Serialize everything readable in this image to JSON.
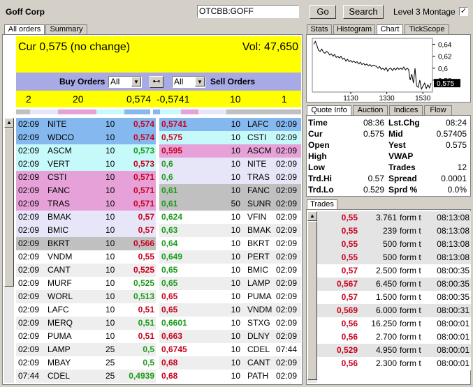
{
  "header": {
    "company": "Goff Corp",
    "symbol_value": "OTCBB:GOFF",
    "go_label": "Go",
    "search_label": "Search",
    "montage_label": "Level 3 Montage",
    "montage_checked": "✓"
  },
  "left_tabs": [
    "All orders",
    "Summary"
  ],
  "summary": {
    "cur": "Cur 0,575 (no change)",
    "vol": "Vol: 47,650"
  },
  "buy_orders_label": "Buy Orders",
  "sell_orders_label": "Sell Orders",
  "buy_filter": "All",
  "sell_filter": "All",
  "link_icon": "⊷",
  "totals": {
    "buy_count": "2",
    "buy_size": "20",
    "buy_price": "0,574",
    "sell_price": "-0,5741",
    "sell_size": "10",
    "sell_count": "1"
  },
  "bid_rows": [
    {
      "time": "02:09",
      "mm": "NITE",
      "size": "10",
      "price": "0,574",
      "c": "red",
      "bg": "#84b8ee"
    },
    {
      "time": "02:09",
      "mm": "WDCO",
      "size": "10",
      "price": "0,574",
      "c": "red",
      "bg": "#84b8ee"
    },
    {
      "time": "02:09",
      "mm": "ASCM",
      "size": "10",
      "price": "0,573",
      "c": "grn",
      "bg": "#c6fafa"
    },
    {
      "time": "02:09",
      "mm": "VERT",
      "size": "10",
      "price": "0,573",
      "c": "red",
      "bg": "#c6fafa"
    },
    {
      "time": "02:09",
      "mm": "CSTI",
      "size": "10",
      "price": "0,571",
      "c": "red",
      "bg": "#e6a2d8"
    },
    {
      "time": "02:09",
      "mm": "FANC",
      "size": "10",
      "price": "0,571",
      "c": "red",
      "bg": "#e6a2d8"
    },
    {
      "time": "02:09",
      "mm": "TRAS",
      "size": "10",
      "price": "0,571",
      "c": "red",
      "bg": "#e6a2d8"
    },
    {
      "time": "02:09",
      "mm": "BMAK",
      "size": "10",
      "price": "0,57",
      "c": "red",
      "bg": "#e6e6f8"
    },
    {
      "time": "02:09",
      "mm": "BMIC",
      "size": "10",
      "price": "0,57",
      "c": "red",
      "bg": "#e6e6f8"
    },
    {
      "time": "02:09",
      "mm": "BKRT",
      "size": "10",
      "price": "0,566",
      "c": "red",
      "bg": "#c0c0c0"
    },
    {
      "time": "02:09",
      "mm": "VNDM",
      "size": "10",
      "price": "0,55",
      "c": "red",
      "bg": "#ffffff"
    },
    {
      "time": "02:09",
      "mm": "CANT",
      "size": "10",
      "price": "0,525",
      "c": "red",
      "bg": "#eeeeee"
    },
    {
      "time": "02:09",
      "mm": "MURF",
      "size": "10",
      "price": "0,525",
      "c": "grn",
      "bg": "#ffffff"
    },
    {
      "time": "02:09",
      "mm": "WORL",
      "size": "10",
      "price": "0,513",
      "c": "grn",
      "bg": "#eeeeee"
    },
    {
      "time": "02:09",
      "mm": "LAFC",
      "size": "10",
      "price": "0,51",
      "c": "red",
      "bg": "#ffffff"
    },
    {
      "time": "02:09",
      "mm": "MERQ",
      "size": "10",
      "price": "0,51",
      "c": "grn",
      "bg": "#eeeeee"
    },
    {
      "time": "02:09",
      "mm": "PUMA",
      "size": "10",
      "price": "0,51",
      "c": "red",
      "bg": "#ffffff"
    },
    {
      "time": "02:09",
      "mm": "LAMP",
      "size": "25",
      "price": "0,5",
      "c": "grn",
      "bg": "#eeeeee"
    },
    {
      "time": "02:09",
      "mm": "MBAY",
      "size": "25",
      "price": "0,5",
      "c": "grn",
      "bg": "#ffffff"
    },
    {
      "time": "07:44",
      "mm": "CDEL",
      "size": "25",
      "price": "0,4939",
      "c": "grn",
      "bg": "#eeeeee"
    }
  ],
  "ask_rows": [
    {
      "price": "0,5741",
      "c": "red",
      "size": "10",
      "mm": "LAFC",
      "time": "02:09",
      "bg": "#84b8ee"
    },
    {
      "price": "0,575",
      "c": "red",
      "size": "10",
      "mm": "CSTI",
      "time": "02:09",
      "bg": "#c6fafa"
    },
    {
      "price": "0,595",
      "c": "red",
      "size": "10",
      "mm": "ASCM",
      "time": "02:09",
      "bg": "#e6a2d8"
    },
    {
      "price": "0,6",
      "c": "grn",
      "size": "10",
      "mm": "NITE",
      "time": "02:09",
      "bg": "#e6e6f8"
    },
    {
      "price": "0,6",
      "c": "grn",
      "size": "10",
      "mm": "TRAS",
      "time": "02:09",
      "bg": "#e6e6f8"
    },
    {
      "price": "0,61",
      "c": "grn",
      "size": "10",
      "mm": "FANC",
      "time": "02:09",
      "bg": "#c0c0c0"
    },
    {
      "price": "0,61",
      "c": "grn",
      "size": "50",
      "mm": "SUNR",
      "time": "02:09",
      "bg": "#c0c0c0"
    },
    {
      "price": "0,624",
      "c": "grn",
      "size": "10",
      "mm": "VFIN",
      "time": "02:09",
      "bg": "#ffffff"
    },
    {
      "price": "0,63",
      "c": "grn",
      "size": "10",
      "mm": "BMAK",
      "time": "02:09",
      "bg": "#eeeeee"
    },
    {
      "price": "0,64",
      "c": "grn",
      "size": "10",
      "mm": "BKRT",
      "time": "02:09",
      "bg": "#ffffff"
    },
    {
      "price": "0,649",
      "c": "grn",
      "size": "10",
      "mm": "PERT",
      "time": "02:09",
      "bg": "#eeeeee"
    },
    {
      "price": "0,65",
      "c": "grn",
      "size": "10",
      "mm": "BMIC",
      "time": "02:09",
      "bg": "#ffffff"
    },
    {
      "price": "0,65",
      "c": "grn",
      "size": "10",
      "mm": "LAMP",
      "time": "02:09",
      "bg": "#eeeeee"
    },
    {
      "price": "0,65",
      "c": "red",
      "size": "10",
      "mm": "PUMA",
      "time": "02:09",
      "bg": "#ffffff"
    },
    {
      "price": "0,65",
      "c": "red",
      "size": "10",
      "mm": "VNDM",
      "time": "02:09",
      "bg": "#eeeeee"
    },
    {
      "price": "0,6601",
      "c": "grn",
      "size": "10",
      "mm": "STXG",
      "time": "02:09",
      "bg": "#ffffff"
    },
    {
      "price": "0,663",
      "c": "red",
      "size": "10",
      "mm": "DLNY",
      "time": "02:09",
      "bg": "#eeeeee"
    },
    {
      "price": "0,6745",
      "c": "red",
      "size": "10",
      "mm": "CDEL",
      "time": "07:44",
      "bg": "#ffffff"
    },
    {
      "price": "0,68",
      "c": "red",
      "size": "10",
      "mm": "CANT",
      "time": "02:09",
      "bg": "#eeeeee"
    },
    {
      "price": "0,68",
      "c": "red",
      "size": "10",
      "mm": "PATH",
      "time": "02:09",
      "bg": "#ffffff"
    }
  ],
  "chart_tabs": [
    "Stats",
    "Histogram",
    "Chart",
    "TickScope"
  ],
  "chart_data": {
    "type": "line",
    "x_ticks": [
      "1130",
      "1330",
      "1530"
    ],
    "y_ticks": [
      "0,64",
      "0,62",
      "0,6",
      "0,58"
    ],
    "last_label": "0,575",
    "ylim": [
      0.56,
      0.65
    ],
    "values": [
      0.64,
      0.645,
      0.638,
      0.63,
      0.628,
      0.632,
      0.627,
      0.625,
      0.628,
      0.626,
      0.622,
      0.624,
      0.62,
      0.623,
      0.618,
      0.62,
      0.617,
      0.62,
      0.615,
      0.617,
      0.612,
      0.615,
      0.611,
      0.613,
      0.61,
      0.612,
      0.609,
      0.611,
      0.607,
      0.61,
      0.606,
      0.608,
      0.605,
      0.607,
      0.604,
      0.606,
      0.603,
      0.605,
      0.604,
      0.603,
      0.6,
      0.603,
      0.598,
      0.6,
      0.597,
      0.601,
      0.595,
      0.599,
      0.6,
      0.596,
      0.6,
      0.597,
      0.601,
      0.598,
      0.6,
      0.598,
      0.602,
      0.597,
      0.6,
      0.598,
      0.58,
      0.59,
      0.575,
      0.6,
      0.57,
      0.568,
      0.58,
      0.565,
      0.57,
      0.575,
      0.566,
      0.572,
      0.567,
      0.575
    ]
  },
  "quote_tabs": [
    "Quote Info",
    "Auction",
    "Indices",
    "Flow"
  ],
  "quote": [
    {
      "l1": "Time",
      "v1": "08:36",
      "l2": "Lst.Chg",
      "v2": "08:24"
    },
    {
      "l1": "Cur",
      "v1": "0.575",
      "l2": "Mid",
      "v2": "0.57405"
    },
    {
      "l1": "Open",
      "v1": "",
      "l2": "Yest",
      "v2": "0.575"
    },
    {
      "l1": "High",
      "v1": "",
      "l2": "VWAP",
      "v2": ""
    },
    {
      "l1": "Low",
      "v1": "",
      "l2": "Trades",
      "v2": "12"
    },
    {
      "l1": "Trd.Hi",
      "v1": "0.57",
      "l2": "Spread",
      "v2": "0.0001"
    },
    {
      "l1": "Trd.Lo",
      "v1": "0.529",
      "l2": "Sprd %",
      "v2": "0.0%"
    }
  ],
  "trades_tab": "Trades",
  "trades": [
    {
      "price": "0,55",
      "qty": "3.761",
      "cond": "form t",
      "time": "08:13:08",
      "bg": "#e4e4e4"
    },
    {
      "price": "0,55",
      "qty": "239",
      "cond": "form t",
      "time": "08:13:08",
      "bg": "#e4e4e4"
    },
    {
      "price": "0,55",
      "qty": "500",
      "cond": "form t",
      "time": "08:13:08",
      "bg": "#e4e4e4"
    },
    {
      "price": "0,55",
      "qty": "500",
      "cond": "form t",
      "time": "08:13:08",
      "bg": "#e4e4e4"
    },
    {
      "price": "0,57",
      "qty": "2.500",
      "cond": "form t",
      "time": "08:00:35",
      "bg": "#ffffff"
    },
    {
      "price": "0,567",
      "qty": "6.450",
      "cond": "form t",
      "time": "08:00:35",
      "bg": "#e4e4e4"
    },
    {
      "price": "0,57",
      "qty": "1.500",
      "cond": "form t",
      "time": "08:00:35",
      "bg": "#ffffff"
    },
    {
      "price": "0,569",
      "qty": "6.000",
      "cond": "form t",
      "time": "08:00:31",
      "bg": "#e4e4e4"
    },
    {
      "price": "0,56",
      "qty": "16.250",
      "cond": "form t",
      "time": "08:00:01",
      "bg": "#ffffff"
    },
    {
      "price": "0,56",
      "qty": "2.700",
      "cond": "form t",
      "time": "08:00:01",
      "bg": "#ffffff"
    },
    {
      "price": "0,529",
      "qty": "4.950",
      "cond": "form t",
      "time": "08:00:01",
      "bg": "#e4e4e4"
    },
    {
      "price": "0,56",
      "qty": "2.300",
      "cond": "form t",
      "time": "08:00:01",
      "bg": "#ffffff"
    }
  ],
  "colors": {
    "yellow": "#ffff00",
    "lavender": "#a8aae6",
    "red": "#c8001e",
    "green": "#1a9b1a"
  }
}
